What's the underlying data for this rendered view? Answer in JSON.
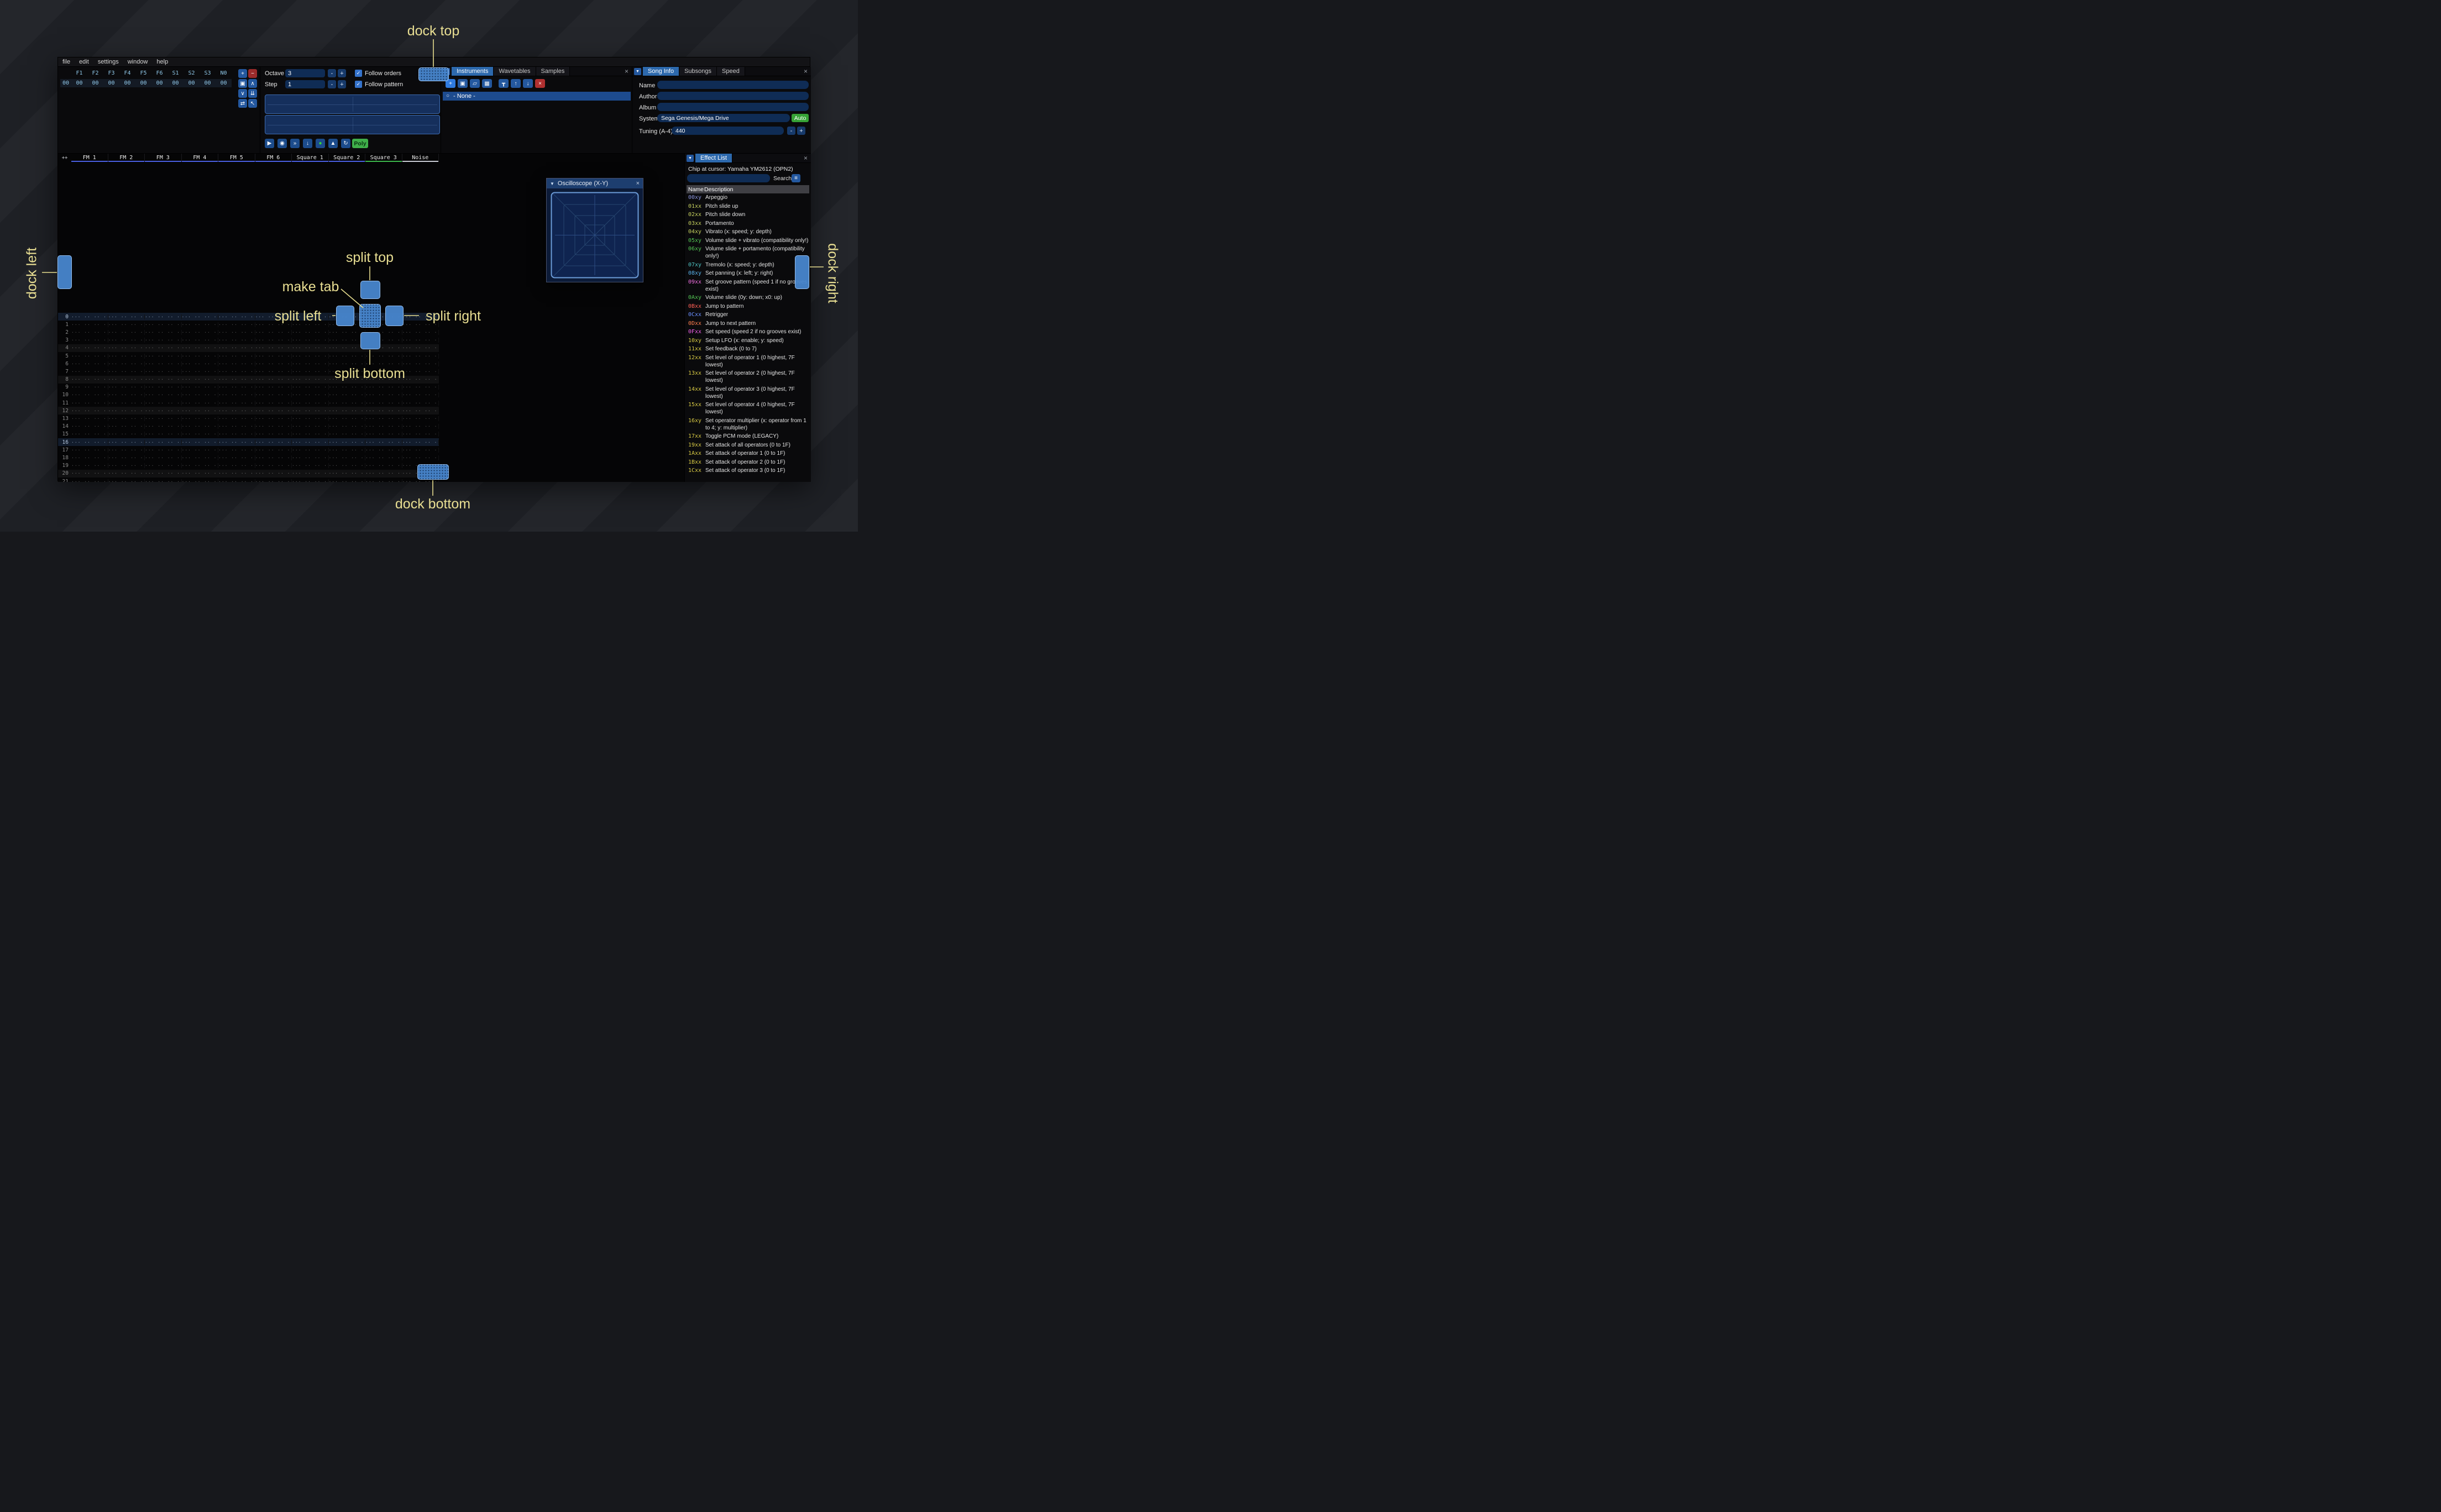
{
  "annotations": {
    "dock_top": "dock top",
    "dock_bottom": "dock bottom",
    "dock_left": "dock left",
    "dock_right": "dock right",
    "split_top": "split top",
    "split_bottom": "split bottom",
    "split_left": "split left",
    "split_right": "split right",
    "make_tab": "make tab",
    "accent_color": "#e9df93"
  },
  "icons": {
    "collapse": "▼",
    "close": "×",
    "menu": "≡",
    "radio": "○",
    "check": "✓"
  },
  "menu": {
    "items": [
      "file",
      "edit",
      "settings",
      "window",
      "help"
    ]
  },
  "orders": {
    "header": [
      "F1",
      "F2",
      "F3",
      "F4",
      "F5",
      "F6",
      "S1",
      "S2",
      "S3",
      "N0"
    ],
    "row_index": "00",
    "row_values": [
      "00",
      "00",
      "00",
      "00",
      "00",
      "00",
      "00",
      "00",
      "00",
      "00"
    ],
    "buttons": [
      {
        "name": "add",
        "glyph": "+",
        "style": "blue"
      },
      {
        "name": "remove",
        "glyph": "−",
        "style": "red"
      },
      {
        "name": "duplicate",
        "glyph": "▣",
        "style": "blue"
      },
      {
        "name": "move-up",
        "glyph": "∧",
        "style": "blue"
      },
      {
        "name": "move-down",
        "glyph": "∨",
        "style": "blue"
      },
      {
        "name": "duplicate-end",
        "glyph": "⇊",
        "style": "blue"
      },
      {
        "name": "change-all",
        "glyph": "⇄",
        "style": "blue"
      },
      {
        "name": "edit-mode",
        "glyph": "↖",
        "style": "blue"
      }
    ]
  },
  "transport": {
    "octave_label": "Octave",
    "octave_value": "3",
    "step_label": "Step",
    "step_value": "1",
    "minus_label": "-",
    "plus_label": "+",
    "follow_orders_label": "Follow orders",
    "follow_pattern_label": "Follow pattern",
    "buttons": [
      {
        "name": "play",
        "glyph": "▶"
      },
      {
        "name": "play-pattern",
        "glyph": "◉"
      },
      {
        "name": "play-from-cursor",
        "glyph": "»"
      },
      {
        "name": "stop",
        "glyph": "↓"
      },
      {
        "name": "record",
        "glyph": "●",
        "color": "#3ad43a"
      },
      {
        "name": "metronome",
        "glyph": "▲"
      },
      {
        "name": "repeat",
        "glyph": "↻"
      }
    ],
    "poly_label": "Poly"
  },
  "instruments": {
    "tabs": [
      {
        "label": "Instruments",
        "active": true
      },
      {
        "label": "Wavetables",
        "active": false
      },
      {
        "label": "Samples",
        "active": false
      }
    ],
    "toolbar": [
      {
        "name": "add",
        "glyph": "+",
        "style": "bright"
      },
      {
        "name": "duplicate",
        "glyph": "▣",
        "style": "blue"
      },
      {
        "name": "open",
        "glyph": "▱",
        "style": "blue"
      },
      {
        "name": "save",
        "glyph": "▦",
        "style": "blue"
      },
      {
        "name": "organize",
        "glyph": "┳",
        "style": "blue"
      },
      {
        "name": "move-up",
        "glyph": "↑",
        "style": "blue"
      },
      {
        "name": "move-down",
        "glyph": "↓",
        "style": "blue"
      },
      {
        "name": "delete",
        "glyph": "×",
        "style": "red"
      }
    ],
    "selected_item": "- None -"
  },
  "song_info": {
    "tabs": [
      {
        "label": "Song Info",
        "active": true
      },
      {
        "label": "Subsongs",
        "active": false
      },
      {
        "label": "Speed",
        "active": false
      }
    ],
    "name_label": "Name",
    "author_label": "Author",
    "album_label": "Album",
    "system_label": "System",
    "system_value": "Sega Genesis/Mega Drive",
    "auto_label": "Auto",
    "tuning_label": "Tuning (A-4)",
    "tuning_value": "440",
    "minus_label": "-",
    "plus_label": "+"
  },
  "pattern": {
    "corner": "++",
    "rows": 22,
    "empty_cell": "··· ·· ·· ····",
    "channels": [
      {
        "name": "FM 1",
        "color": "#4a5fe0"
      },
      {
        "name": "FM 2",
        "color": "#4a5fe0"
      },
      {
        "name": "FM 3",
        "color": "#4a5fe0"
      },
      {
        "name": "FM 4",
        "color": "#4a5fe0"
      },
      {
        "name": "FM 5",
        "color": "#4a5fe0"
      },
      {
        "name": "FM 6",
        "color": "#4a5fe0"
      },
      {
        "name": "Square 1",
        "color": "#4a5fe0"
      },
      {
        "name": "Square 2",
        "color": "#4a5fe0"
      },
      {
        "name": "Square 3",
        "color": "#3db84b"
      },
      {
        "name": "Noise",
        "color": "#c9ccd4"
      }
    ]
  },
  "oscilloscope": {
    "title": "Oscilloscope (X-Y)"
  },
  "effect_list": {
    "tab_label": "Effect List",
    "chip_label": "Chip at cursor: Yamaha YM2612 (OPN2)",
    "search_label": "Search",
    "name_header": "Name",
    "desc_header": "Description",
    "effects": [
      {
        "code": "00xy",
        "color": "#8b95dd",
        "desc": "Arpeggio"
      },
      {
        "code": "01xx",
        "color": "#c5d05e",
        "desc": "Pitch slide up"
      },
      {
        "code": "02xx",
        "color": "#c5d05e",
        "desc": "Pitch slide down"
      },
      {
        "code": "03xx",
        "color": "#c5d05e",
        "desc": "Portamento"
      },
      {
        "code": "04xy",
        "color": "#c5d05e",
        "desc": "Vibrato (x: speed; y: depth)"
      },
      {
        "code": "05xy",
        "color": "#53c553",
        "desc": "Volume slide + vibrato (compatibility only!)"
      },
      {
        "code": "06xy",
        "color": "#53c553",
        "desc": "Volume slide + portamento (compatibility only!)"
      },
      {
        "code": "07xy",
        "color": "#4fc5c5",
        "desc": "Tremolo (x: speed; y: depth)"
      },
      {
        "code": "08xy",
        "color": "#58b1e8",
        "desc": "Set panning (x: left; y: right)"
      },
      {
        "code": "09xx",
        "color": "#ef6ee0",
        "desc": "Set groove pattern (speed 1 if no grooves exist)"
      },
      {
        "code": "0Axy",
        "color": "#53c553",
        "desc": "Volume slide (0y: down; x0: up)"
      },
      {
        "code": "0Bxx",
        "color": "#ff6055",
        "desc": "Jump to pattern"
      },
      {
        "code": "0Cxx",
        "color": "#6a8fff",
        "desc": "Retrigger"
      },
      {
        "code": "0Dxx",
        "color": "#ff7f4f",
        "desc": "Jump to next pattern"
      },
      {
        "code": "0Fxx",
        "color": "#f060e8",
        "desc": "Set speed (speed 2 if no grooves exist)"
      },
      {
        "code": "10xy",
        "color": "#d8ca44",
        "desc": "Setup LFO (x: enable; y: speed)"
      },
      {
        "code": "11xx",
        "color": "#d8ca44",
        "desc": "Set feedback (0 to 7)"
      },
      {
        "code": "12xx",
        "color": "#d8ca44",
        "desc": "Set level of operator 1 (0 highest, 7F lowest)"
      },
      {
        "code": "13xx",
        "color": "#d8ca44",
        "desc": "Set level of operator 2 (0 highest, 7F lowest)"
      },
      {
        "code": "14xx",
        "color": "#d8ca44",
        "desc": "Set level of operator 3 (0 highest, 7F lowest)"
      },
      {
        "code": "15xx",
        "color": "#d8ca44",
        "desc": "Set level of operator 4 (0 highest, 7F lowest)"
      },
      {
        "code": "16xy",
        "color": "#d8ca44",
        "desc": "Set operator multiplier (x: operator from 1 to 4; y: multiplier)"
      },
      {
        "code": "17xx",
        "color": "#d8ca44",
        "desc": "Toggle PCM mode (LEGACY)"
      },
      {
        "code": "19xx",
        "color": "#d8ca44",
        "desc": "Set attack of all operators (0 to 1F)"
      },
      {
        "code": "1Axx",
        "color": "#d8ca44",
        "desc": "Set attack of operator 1 (0 to 1F)"
      },
      {
        "code": "1Bxx",
        "color": "#d8ca44",
        "desc": "Set attack of operator 2 (0 to 1F)"
      },
      {
        "code": "1Cxx",
        "color": "#d8ca44",
        "desc": "Set attack of operator 3 (0 to 1F)"
      }
    ]
  }
}
